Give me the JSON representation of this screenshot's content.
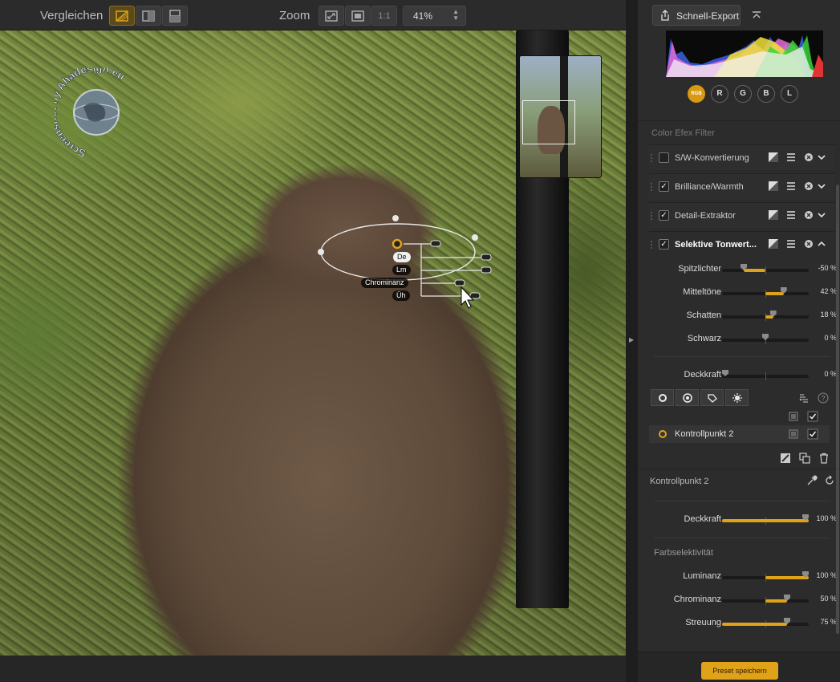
{
  "toolbar": {
    "compare_label": "Vergleichen",
    "zoom_label": "Zoom",
    "zoom_one_to_one": "1:1",
    "zoom_value": "41%"
  },
  "canvas": {
    "watermark_text": "Screenshot by Ahadesign.eu",
    "control_point": {
      "tags": [
        "De",
        "Lm",
        "Chrominanz",
        "Üh"
      ],
      "active_tag": "De"
    }
  },
  "panel": {
    "export_label": "Schnell-Export",
    "channels": [
      "RGB",
      "R",
      "G",
      "B",
      "L"
    ],
    "active_channel": "RGB",
    "filters_header": "Color Efex Filter",
    "filters": [
      {
        "name": "S/W-Konvertierung",
        "checked": false,
        "expanded": false
      },
      {
        "name": "Brilliance/Warmth",
        "checked": true,
        "expanded": false
      },
      {
        "name": "Detail-Extraktor",
        "checked": true,
        "expanded": false
      },
      {
        "name": "Selektive Tonwert...",
        "checked": true,
        "expanded": true
      }
    ],
    "tone_sliders": [
      {
        "label": "Spitzlichter",
        "value": "-50 %",
        "num": -50
      },
      {
        "label": "Mitteltöne",
        "value": "42 %",
        "num": 42
      },
      {
        "label": "Schatten",
        "value": "18 %",
        "num": 18
      },
      {
        "label": "Schwarz",
        "value": "0 %",
        "num": 0
      }
    ],
    "opacity_slider": {
      "label": "Deckkraft",
      "value": "0 %",
      "num": 0
    },
    "control_point_item": "Kontrollpunkt 2",
    "control_point_section_title": "Kontrollpunkt 2",
    "cp_opacity_slider": {
      "label": "Deckkraft",
      "value": "100 %",
      "num": 100
    },
    "color_selectivity_title": "Farbselektivität",
    "selectivity_sliders": [
      {
        "label": "Luminanz",
        "value": "100 %",
        "num": 100
      },
      {
        "label": "Chrominanz",
        "value": "50 %",
        "num": 50
      },
      {
        "label": "Streuung",
        "value": "75 %",
        "num": 75
      }
    ],
    "save_preset_label": "Preset speichern"
  },
  "colors": {
    "accent": "#e0a218",
    "panel_bg": "#2c2c2c",
    "toolbar_bg": "#2b2b2b"
  },
  "icons": {
    "compare": [
      "compare-split-icon",
      "compare-side-icon",
      "compare-stack-icon"
    ],
    "zoom": [
      "zoom-fit-icon",
      "zoom-fill-icon"
    ],
    "filter_row": [
      "mask-icon",
      "menu-icon",
      "remove-icon",
      "chevron-icon"
    ],
    "tools": [
      "control-point-tool-icon",
      "brush-tool-icon",
      "shape-tool-icon",
      "auto-mask-tool-icon"
    ]
  }
}
